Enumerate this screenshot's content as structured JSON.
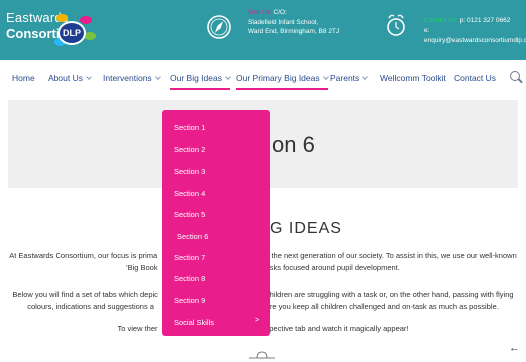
{
  "header": {
    "logo": {
      "line1": "Eastwards",
      "line2": "Consortium",
      "badge": "DLP"
    },
    "visit": {
      "label": "Visit Us:",
      "line1": "C/O:",
      "line2": "Sladefield Infant School,",
      "line3": "Ward End, Birmingham, B8 2TJ"
    },
    "contact": {
      "label": "Contact Us:",
      "phone": "p: 0121 327 0662",
      "email": "e: enquiry@eastwardsconsortiumdlp.co.uk"
    },
    "colors": {
      "bar": "#2f9aa3",
      "accent_pink": "#e91e8c",
      "accent_green": "#1ed760"
    }
  },
  "nav": {
    "items": [
      {
        "label": "Home"
      },
      {
        "label": "About Us"
      },
      {
        "label": "Interventions"
      },
      {
        "label": "Our Big Ideas"
      },
      {
        "label": "Our Primary Big Ideas"
      },
      {
        "label": "Parents"
      },
      {
        "label": "Wellcomm Toolkit"
      },
      {
        "label": "Contact Us"
      }
    ],
    "search_icon": "search-icon"
  },
  "title_band": {
    "title": "on 6"
  },
  "dropdown": {
    "items": [
      {
        "label": "Section 1"
      },
      {
        "label": "Section 2"
      },
      {
        "label": "Section 3"
      },
      {
        "label": "Section 4"
      },
      {
        "label": "Section 5"
      },
      {
        "label": "Section 6"
      },
      {
        "label": "Section 7"
      },
      {
        "label": "Section 8"
      },
      {
        "label": "Section 9"
      },
      {
        "label": "Social Skills",
        "submenu_arrow": ">"
      }
    ]
  },
  "content": {
    "heading": "G IDEAS",
    "para1_left": "At Eastwards Consortium, our focus is prima",
    "para1_right": "g the next generation of our society. To assist in this, we use our well-known",
    "para1b_left": "'Big Book",
    "para1b_right": "asks focused around pupil development.",
    "para2_left": "Below you will find a set of tabs which depic",
    "para2_right": "children are struggling with a task or, on the other hand, passing with flying",
    "para2b_left": "colours, indications and suggestions a",
    "para2b_right": "sure you keep all children challenged and on-task as much as possible.",
    "para3_left": "To view ther",
    "para3_right": "spective tab and watch it magically appear!",
    "back_arrow": "←"
  }
}
